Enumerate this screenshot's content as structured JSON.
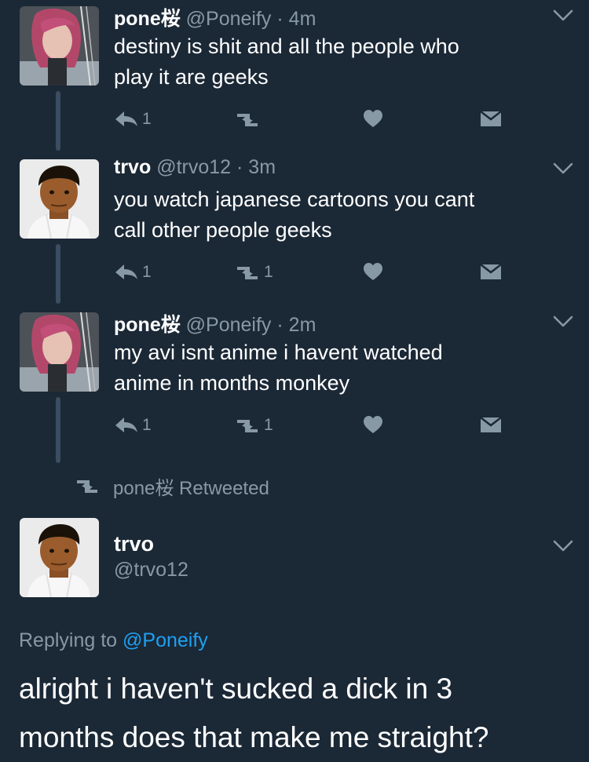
{
  "colors": {
    "background": "#1b2836",
    "secondary_text": "#8899a6",
    "link": "#1da1f2",
    "thread_line": "#3b4d60"
  },
  "tweets": [
    {
      "name": "pone桜",
      "handle": "@Poneify",
      "time": "· 4m",
      "text_line1": "destiny is shit and all the people who",
      "text_line2": "play it are geeks",
      "reply_count": "1",
      "retweet_count": "",
      "avatar_icon": "avatar-red-hair-woman"
    },
    {
      "name": "trvo",
      "handle": "@trvo12",
      "time": "· 3m",
      "text_line1": "you watch japanese cartoons you cant",
      "text_line2": "call other people geeks",
      "reply_count": "1",
      "retweet_count": "1",
      "avatar_icon": "avatar-cartoon-man"
    },
    {
      "name": "pone桜",
      "handle": "@Poneify",
      "time": "· 2m",
      "text_line1": "my avi isnt anime i havent watched",
      "text_line2": "anime in months monkey",
      "reply_count": "1",
      "retweet_count": "1",
      "avatar_icon": "avatar-red-hair-woman"
    }
  ],
  "retweeted_label": "pone桜 Retweeted",
  "main_tweet": {
    "name": "trvo",
    "handle": "@trvo12",
    "replying_prefix": "Replying to",
    "replying_mention": "@Poneify",
    "text_line1": "alright i haven't sucked a dick in 3",
    "text_line2": "months does that make me straight?"
  },
  "icons": [
    "reply-icon",
    "retweet-icon",
    "like-icon",
    "dm-icon",
    "chevron-down-icon"
  ]
}
